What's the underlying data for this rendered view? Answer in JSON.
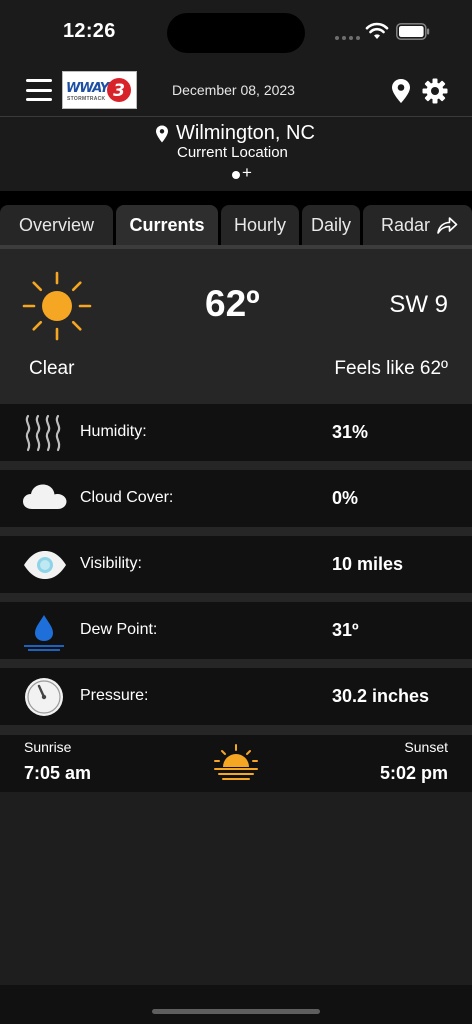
{
  "status_bar": {
    "time": "12:26"
  },
  "header": {
    "logo_text": "WWAY",
    "logo_sub": "STORMTRACK",
    "logo_number": "3",
    "date": "December 08, 2023",
    "icons": [
      "menu-icon",
      "location-pin-icon",
      "gear-icon"
    ]
  },
  "location": {
    "name": "Wilmington, NC",
    "subtitle": "Current Location",
    "add_symbol": "+"
  },
  "tabs": [
    {
      "label": "Overview",
      "active": false
    },
    {
      "label": "Currents",
      "active": true
    },
    {
      "label": "Hourly",
      "active": false
    },
    {
      "label": "Daily",
      "active": false
    },
    {
      "label": "Radar",
      "active": false
    }
  ],
  "current": {
    "temperature": "62º",
    "wind": "SW 9",
    "condition": "Clear",
    "feels_like": "Feels like 62º",
    "icon": "sun-icon"
  },
  "details": [
    {
      "label": "Humidity:",
      "value": "31%",
      "icon": "humidity-icon"
    },
    {
      "label": "Cloud Cover:",
      "value": "0%",
      "icon": "cloud-icon"
    },
    {
      "label": "Visibility:",
      "value": "10 miles",
      "icon": "eye-icon"
    },
    {
      "label": "Dew Point:",
      "value": "31º",
      "icon": "water-drop-icon"
    },
    {
      "label": "Pressure:",
      "value": "30.2 inches",
      "icon": "gauge-icon"
    }
  ],
  "sun_times": {
    "sunrise_label": "Sunrise",
    "sunrise_time": "7:05 am",
    "sunset_label": "Sunset",
    "sunset_time": "5:02 pm"
  },
  "colors": {
    "accent_orange": "#f5a623",
    "water_blue": "#1e6fd9",
    "background": "#1e1e1e"
  }
}
